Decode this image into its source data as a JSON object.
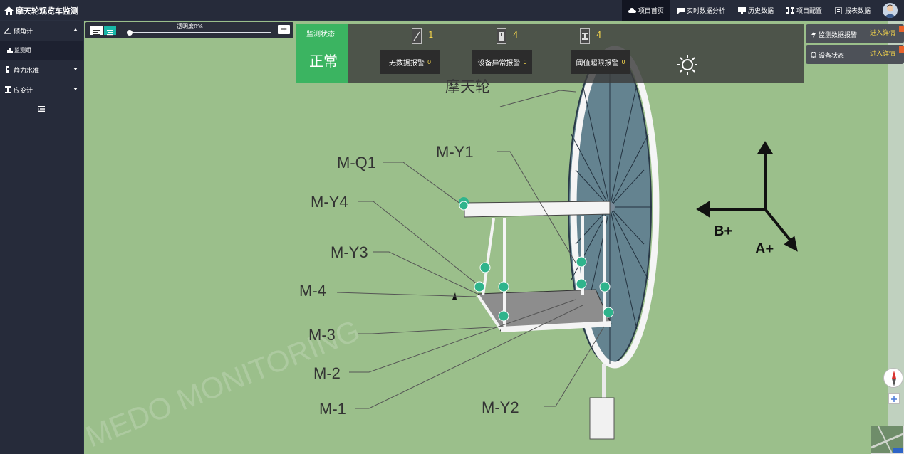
{
  "app": {
    "title": "摩天轮观览车监测"
  },
  "topnav": [
    {
      "label": "项目首页",
      "icon": "cloud-icon",
      "active": true
    },
    {
      "label": "实时数据分析",
      "icon": "chat-icon"
    },
    {
      "label": "历史数据",
      "icon": "monitor-icon"
    },
    {
      "label": "项目配置",
      "icon": "network-icon"
    },
    {
      "label": "报表数据",
      "icon": "report-icon"
    }
  ],
  "sidebar": {
    "items": [
      {
        "label": "倾角计",
        "icon": "angle-icon",
        "expanded": true,
        "children": [
          {
            "label": "监测组",
            "icon": "group-icon"
          }
        ]
      },
      {
        "label": "静力水准",
        "icon": "level-icon",
        "expanded": false
      },
      {
        "label": "应变计",
        "icon": "strain-icon",
        "expanded": false
      }
    ]
  },
  "toolbar": {
    "opacity_label": "透明度0%",
    "plus": "+",
    "opacity_value": 0
  },
  "monitor": {
    "status_label": "监测状态",
    "status_value": "正常",
    "counters": [
      {
        "icon": "inclinometer-icon",
        "value": "1"
      },
      {
        "icon": "level-sensor-icon",
        "value": "4"
      },
      {
        "icon": "strain-sensor-icon",
        "value": "4"
      }
    ],
    "alarms": [
      {
        "label": "无数据报警",
        "count": "0"
      },
      {
        "label": "设备异常报警",
        "count": "0"
      },
      {
        "label": "阈值超限报警",
        "count": "0"
      }
    ]
  },
  "right_panels": [
    {
      "title": "监测数据报警",
      "icon": "bolt-icon",
      "detail": "进入详情"
    },
    {
      "title": "设备状态",
      "icon": "bell-icon",
      "detail": "进入详情"
    }
  ],
  "scene": {
    "wheel_label": "摩天轮",
    "sensor_labels": [
      "M-Q1",
      "M-Y4",
      "M-Y3",
      "M-4",
      "M-3",
      "M-2",
      "M-1",
      "M-Y1",
      "M-Y2"
    ],
    "axis_labels": {
      "b": "B+",
      "a": "A+"
    },
    "watermark": "MEDO MONITORING"
  },
  "colors": {
    "status_green": "#3bb461",
    "scene_bg": "#9bbf8b",
    "count_yellow": "#f2d34b",
    "sensor_teal": "#2fb48c"
  }
}
